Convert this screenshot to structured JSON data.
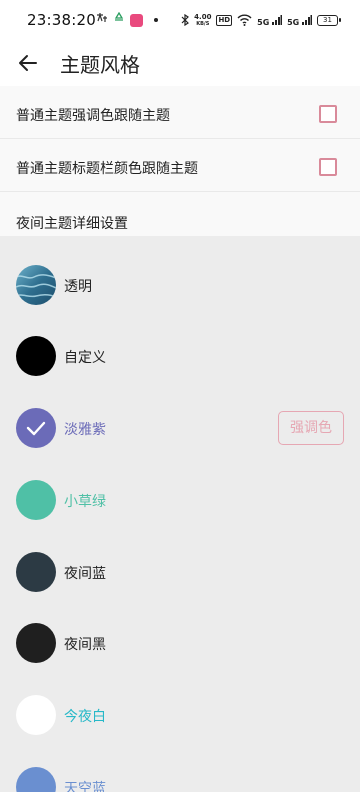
{
  "status_bar": {
    "time": "23:38:20",
    "net_speed_value": "4.00",
    "net_speed_unit": "KB/S",
    "hd": "HD",
    "sim1": "5G",
    "sim2": "5G",
    "battery": "31"
  },
  "header": {
    "title": "主题风格"
  },
  "settings": [
    {
      "label": "普通主题强调色跟随主题",
      "checked": false
    },
    {
      "label": "普通主题标题栏颜色跟随主题",
      "checked": false
    },
    {
      "label": "夜间主题详细设置"
    }
  ],
  "themes": [
    {
      "name": "透明",
      "color": "#3f7e9b",
      "text_color": "#222222",
      "selected": false
    },
    {
      "name": "自定义",
      "color": "#000000",
      "text_color": "#222222",
      "selected": false
    },
    {
      "name": "淡雅紫",
      "color": "#6b6bb8",
      "text_color": "#6b6bb8",
      "selected": true,
      "accent_label": "强调色",
      "accent_color": "#e6a7b3"
    },
    {
      "name": "小草绿",
      "color": "#4fc0a6",
      "text_color": "#4fc0a6",
      "selected": false
    },
    {
      "name": "夜间蓝",
      "color": "#2c3a44",
      "text_color": "#222222",
      "selected": false
    },
    {
      "name": "夜间黑",
      "color": "#1f1f1f",
      "text_color": "#222222",
      "selected": false
    },
    {
      "name": "今夜白",
      "color": "#ffffff",
      "text_color": "#26b8c8",
      "selected": false
    },
    {
      "name": "天空蓝",
      "color": "#6a8fd0",
      "text_color": "#6a8fd0",
      "selected": false
    }
  ]
}
